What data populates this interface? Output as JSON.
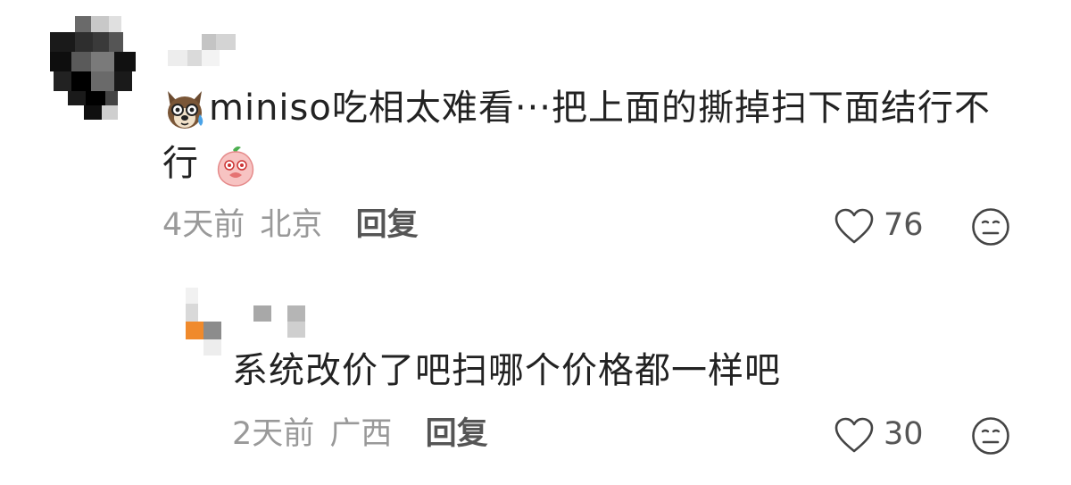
{
  "comments": [
    {
      "text_before": "miniso吃相太难看···把上面的撕掉扫下面结行不",
      "text_line2": "行",
      "time": "4天前",
      "location": "北京",
      "reply_label": "回复",
      "likes": "76",
      "leading_emoji": "dog-emoji",
      "trailing_emoji": "peach-emoji"
    },
    {
      "text": "系统改价了吧扫哪个价格都一样吧",
      "time": "2天前",
      "location": "广西",
      "reply_label": "回复",
      "likes": "30"
    }
  ]
}
